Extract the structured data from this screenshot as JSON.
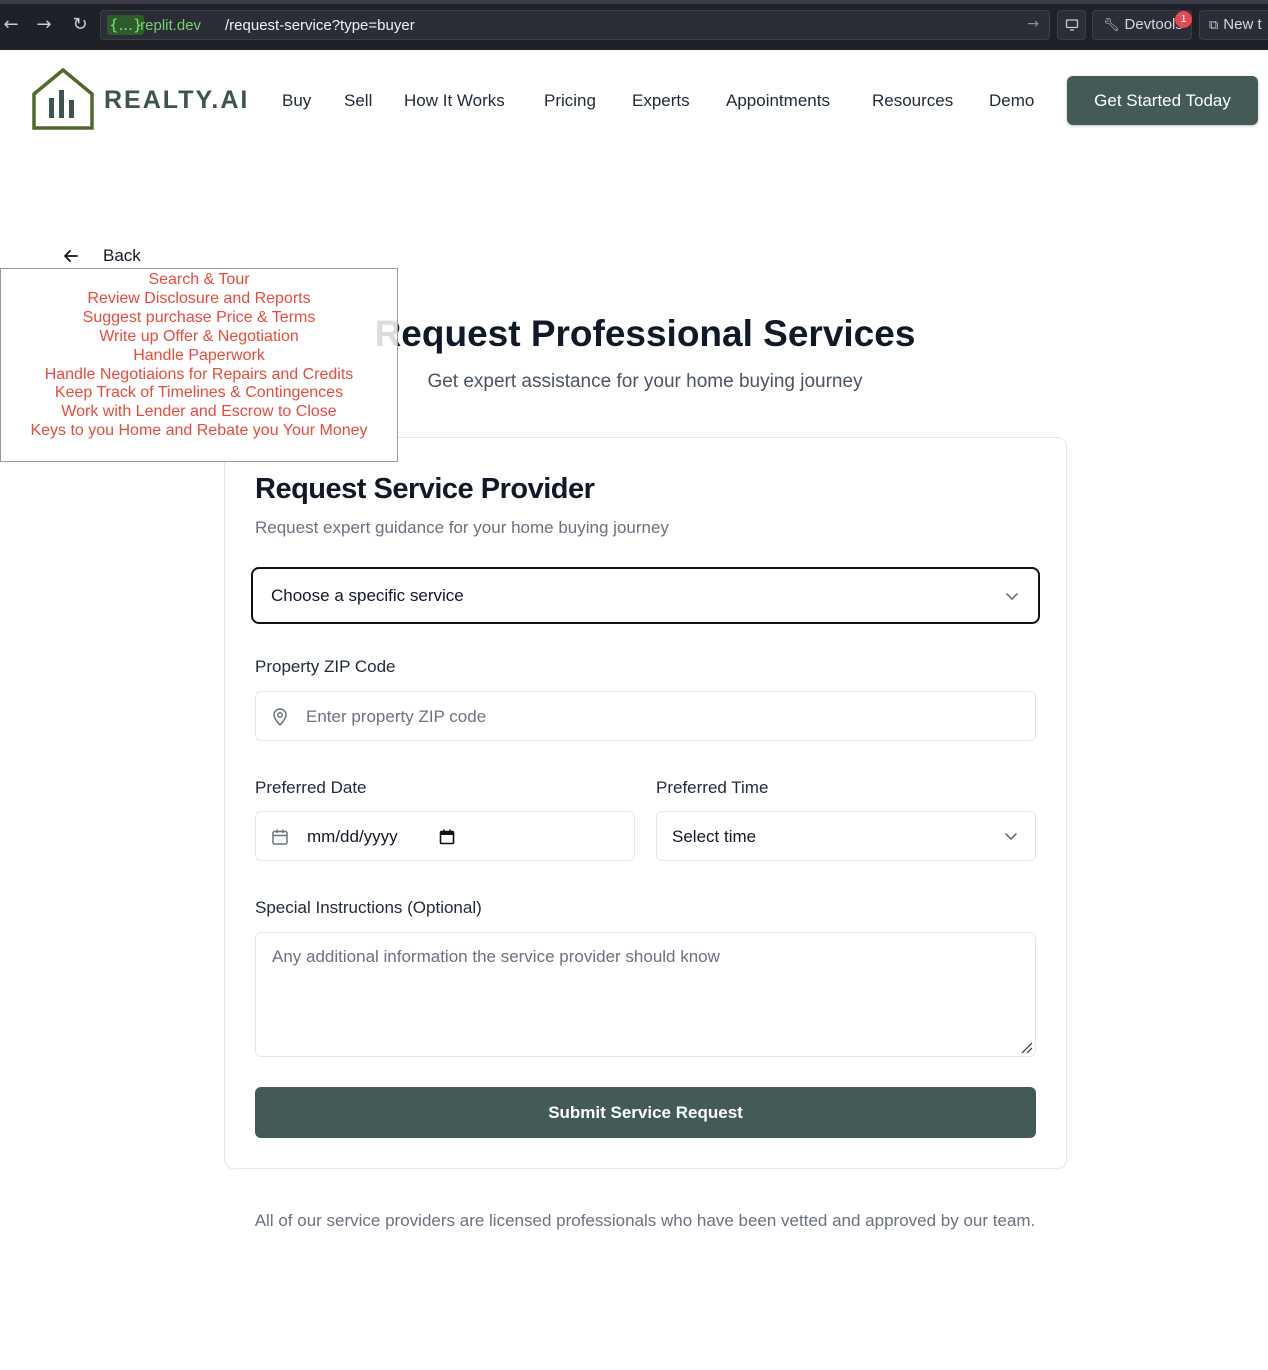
{
  "browser": {
    "url_chip": "{...}",
    "url_host": ".replit.dev",
    "url_path": "/request-service?type=buyer",
    "devtools_label": "Devtools",
    "devtools_badge": "1",
    "new_tab_label": "New t"
  },
  "header": {
    "brand": "REALTY.AI",
    "nav": [
      "Buy",
      "Sell",
      "How It Works",
      "Pricing",
      "Experts",
      "Appointments",
      "Resources",
      "Demo"
    ],
    "cta_label": "Get Started Today"
  },
  "back_label": "Back",
  "service_list": [
    "Search & Tour",
    "Review Disclosure and Reports",
    "Suggest purchase Price & Terms",
    "Write up Offer & Negotiation",
    "Handle Paperwork",
    "Handle Negotiaions for Repairs and Credits",
    "Keep Track of Timelines & Contingences",
    "Work with Lender and Escrow to Close",
    "Keys to you Home and Rebate you Your Money"
  ],
  "hero": {
    "title": "Request Professional Services",
    "subtitle": "Get expert assistance for your home buying journey"
  },
  "form": {
    "title": "Request Service Provider",
    "subtitle": "Request expert guidance for your home buying journey",
    "service_select": "Choose a specific service",
    "zip_label": "Property ZIP Code",
    "zip_placeholder": "Enter property ZIP code",
    "date_label": "Preferred Date",
    "date_value": "mm/dd/yyyy",
    "time_label": "Preferred Time",
    "time_select": "Select time",
    "instructions_label": "Special Instructions (Optional)",
    "instructions_placeholder": "Any additional information the service provider should know",
    "submit_label": "Submit Service Request"
  },
  "footnote": "All of our service providers are licensed professionals who have been vetted and approved by our team.",
  "colors": {
    "brand": "#435a57",
    "logo": "#3f5450",
    "overlay_text": "#ea4b3c",
    "browser_bg": "#1f2128"
  },
  "icons": [
    "back-arrow-icon",
    "forward-arrow-icon",
    "reload-icon",
    "devtools-wrench-icon",
    "external-link-icon",
    "monitor-icon",
    "house-chart-logo",
    "arrow-left-icon",
    "chevron-down-icon",
    "map-pin-icon",
    "calendar-icon",
    "date-picker-icon",
    "resize-handle-icon"
  ]
}
